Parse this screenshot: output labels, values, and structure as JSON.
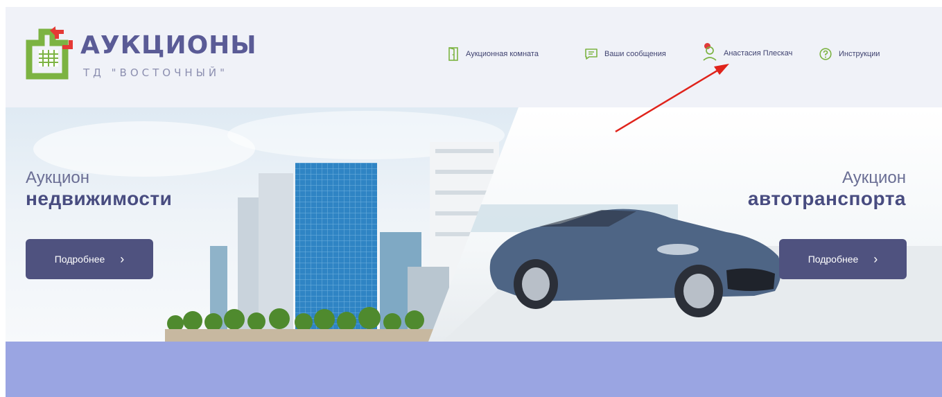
{
  "logo": {
    "title": "АУКЦИОНЫ",
    "subtitle": "ТД \"ВОСТОЧНЫЙ\""
  },
  "nav": {
    "items": [
      {
        "label": "Аукционная комната",
        "icon": "door-icon"
      },
      {
        "label": "Ваши сообщения",
        "icon": "message-icon"
      },
      {
        "label": "Анастасия Плескач",
        "icon": "user-icon"
      },
      {
        "label": "Инструкции",
        "icon": "help-icon"
      }
    ]
  },
  "hero": {
    "left": {
      "small": "Аукцион",
      "big": "недвижимости",
      "button": "Подробнее"
    },
    "right": {
      "small": "Аукцион",
      "big": "автотранспорта",
      "button": "Подробнее"
    }
  },
  "colors": {
    "accent": "#4f527f",
    "logo_green": "#7cb342",
    "logo_red": "#e53935",
    "band": "#9aa5e2",
    "notification": "#e03a3a"
  }
}
